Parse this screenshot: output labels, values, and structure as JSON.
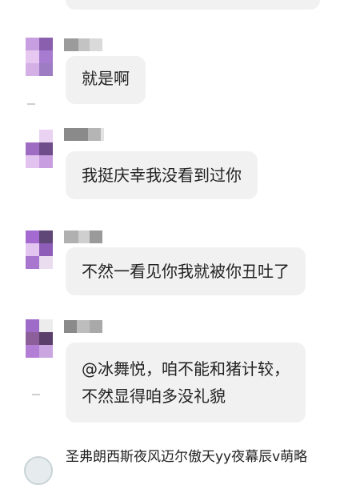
{
  "messages": [
    {
      "lines": [
        "就是啊"
      ]
    },
    {
      "lines": [
        "我挺庆幸我没看到过你"
      ]
    },
    {
      "lines": [
        "不然一看见你我就被你丑吐了"
      ]
    },
    {
      "lines": [
        "@冰舞悦，咱不能和猪计较，",
        "不然显得咱多没礼貌"
      ]
    }
  ],
  "bottom_user": {
    "name": "圣弗朗西斯夜风迈尔傲天yy夜幕辰v萌略"
  },
  "colors": {
    "bubble": "#f1f1f1",
    "text": "#222222",
    "avatar_purple": "#a06cc8",
    "avatar_light": "#e5c6ef",
    "blur_gray": "#8a8a8a"
  }
}
